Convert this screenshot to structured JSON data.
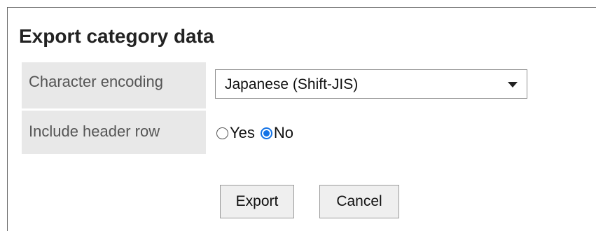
{
  "dialog": {
    "title": "Export category data"
  },
  "form": {
    "encoding": {
      "label": "Character encoding",
      "selected": "Japanese (Shift-JIS)"
    },
    "header_row": {
      "label": "Include header row",
      "options": [
        {
          "label": "Yes",
          "checked": false
        },
        {
          "label": "No",
          "checked": true
        }
      ]
    }
  },
  "buttons": {
    "export_label": "Export",
    "cancel_label": "Cancel"
  },
  "colors": {
    "accent": "#1473e6",
    "label_bg": "#e8e8e8"
  }
}
